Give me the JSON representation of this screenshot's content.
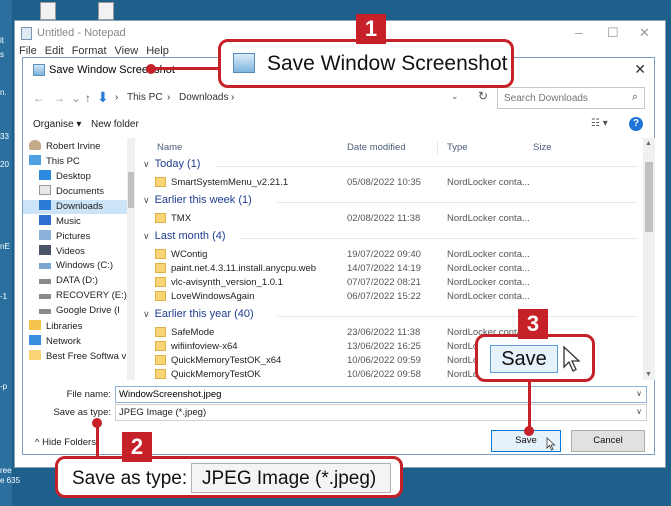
{
  "desktop": {
    "side_labels": [
      "it",
      "s",
      "n.",
      "33",
      "20",
      "nE",
      "-p",
      "-1",
      "-p",
      "ree",
      "e 635"
    ]
  },
  "notepad": {
    "title": "Untitled - Notepad",
    "menu": [
      "File",
      "Edit",
      "Format",
      "View",
      "Help"
    ],
    "controls": [
      "–",
      "☐",
      "✕"
    ]
  },
  "dialog": {
    "title": "Save Window Screenshot",
    "close": "✕",
    "nav": {
      "back": "←",
      "forward": "→",
      "recent": "⌄",
      "up": "↑",
      "path": [
        "This PC",
        "Downloads"
      ],
      "separator": "›",
      "dropdown": "⌄",
      "refresh": "↻"
    },
    "search_placeholder": "Search Downloads",
    "toolbar": {
      "organise": "Organise ▾",
      "new_folder": "New folder",
      "view": "☷ ▾",
      "help": "?"
    },
    "nav_pane": [
      {
        "label": "Robert Irvine",
        "icon": "user-icon"
      },
      {
        "label": "This PC",
        "icon": "computer-icon"
      },
      {
        "label": "Desktop",
        "icon": "desktop-icon"
      },
      {
        "label": "Documents",
        "icon": "documents-icon"
      },
      {
        "label": "Downloads",
        "icon": "downloads-icon"
      },
      {
        "label": "Music",
        "icon": "music-icon"
      },
      {
        "label": "Pictures",
        "icon": "pictures-icon"
      },
      {
        "label": "Videos",
        "icon": "videos-icon"
      },
      {
        "label": "Windows (C:)",
        "icon": "drive-icon"
      },
      {
        "label": "DATA (D:)",
        "icon": "drive-icon"
      },
      {
        "label": "RECOVERY (E:)",
        "icon": "drive-icon"
      },
      {
        "label": "Google Drive (I",
        "icon": "drive-icon"
      },
      {
        "label": "Libraries",
        "icon": "libraries-icon"
      },
      {
        "label": "Network",
        "icon": "network-icon"
      },
      {
        "label": "Best Free Softwa v",
        "icon": "folder-icon"
      }
    ],
    "columns": [
      "Name",
      "Date modified",
      "Type",
      "Size"
    ],
    "groups": [
      {
        "label": "Today (1)",
        "files": [
          {
            "name": "SmartSystemMenu_v2.21.1",
            "date": "05/08/2022 10:35",
            "type": "NordLocker conta..."
          }
        ]
      },
      {
        "label": "Earlier this week (1)",
        "files": [
          {
            "name": "TMX",
            "date": "02/08/2022 11:38",
            "type": "NordLocker conta..."
          }
        ]
      },
      {
        "label": "Last month (4)",
        "files": [
          {
            "name": "WContig",
            "date": "19/07/2022 09:40",
            "type": "NordLocker conta..."
          },
          {
            "name": "paint.net.4.3.11.install.anycpu.web",
            "date": "14/07/2022 14:19",
            "type": "NordLocker conta..."
          },
          {
            "name": "vlc-avisynth_version_1.0.1",
            "date": "07/07/2022 08:21",
            "type": "NordLocker conta..."
          },
          {
            "name": "LoveWindowsAgain",
            "date": "06/07/2022 15:22",
            "type": "NordLocker conta..."
          }
        ]
      },
      {
        "label": "Earlier this year (40)",
        "files": [
          {
            "name": "SafeMode",
            "date": "23/06/2022 11:38",
            "type": "NordLocker conta..."
          },
          {
            "name": "wifiinfoview-x64",
            "date": "13/06/2022 16:25",
            "type": "NordLocker conta..."
          },
          {
            "name": "QuickMemoryTestOK_x64",
            "date": "10/06/2022 09:59",
            "type": "NordLocker conta..."
          },
          {
            "name": "QuickMemoryTestOK",
            "date": "10/06/2022 09:58",
            "type": "NordLocker"
          }
        ]
      }
    ],
    "file_name_label": "File name:",
    "file_name_value": "WindowScreenshot.jpeg",
    "save_as_type_label": "Save as type:",
    "save_as_type_value": "JPEG Image (*.jpeg)",
    "hide_folders": "^ Hide Folders",
    "save_button": "Save",
    "cancel_button": "Cancel"
  },
  "annotations": {
    "badge1": "1",
    "badge2": "2",
    "badge3": "3",
    "callout_title": "Save Window Screenshot",
    "callout_save": "Save",
    "callout_type_label": "Save as type:",
    "callout_type_value": "JPEG Image (*.jpeg)",
    "accent": "#c62028"
  }
}
